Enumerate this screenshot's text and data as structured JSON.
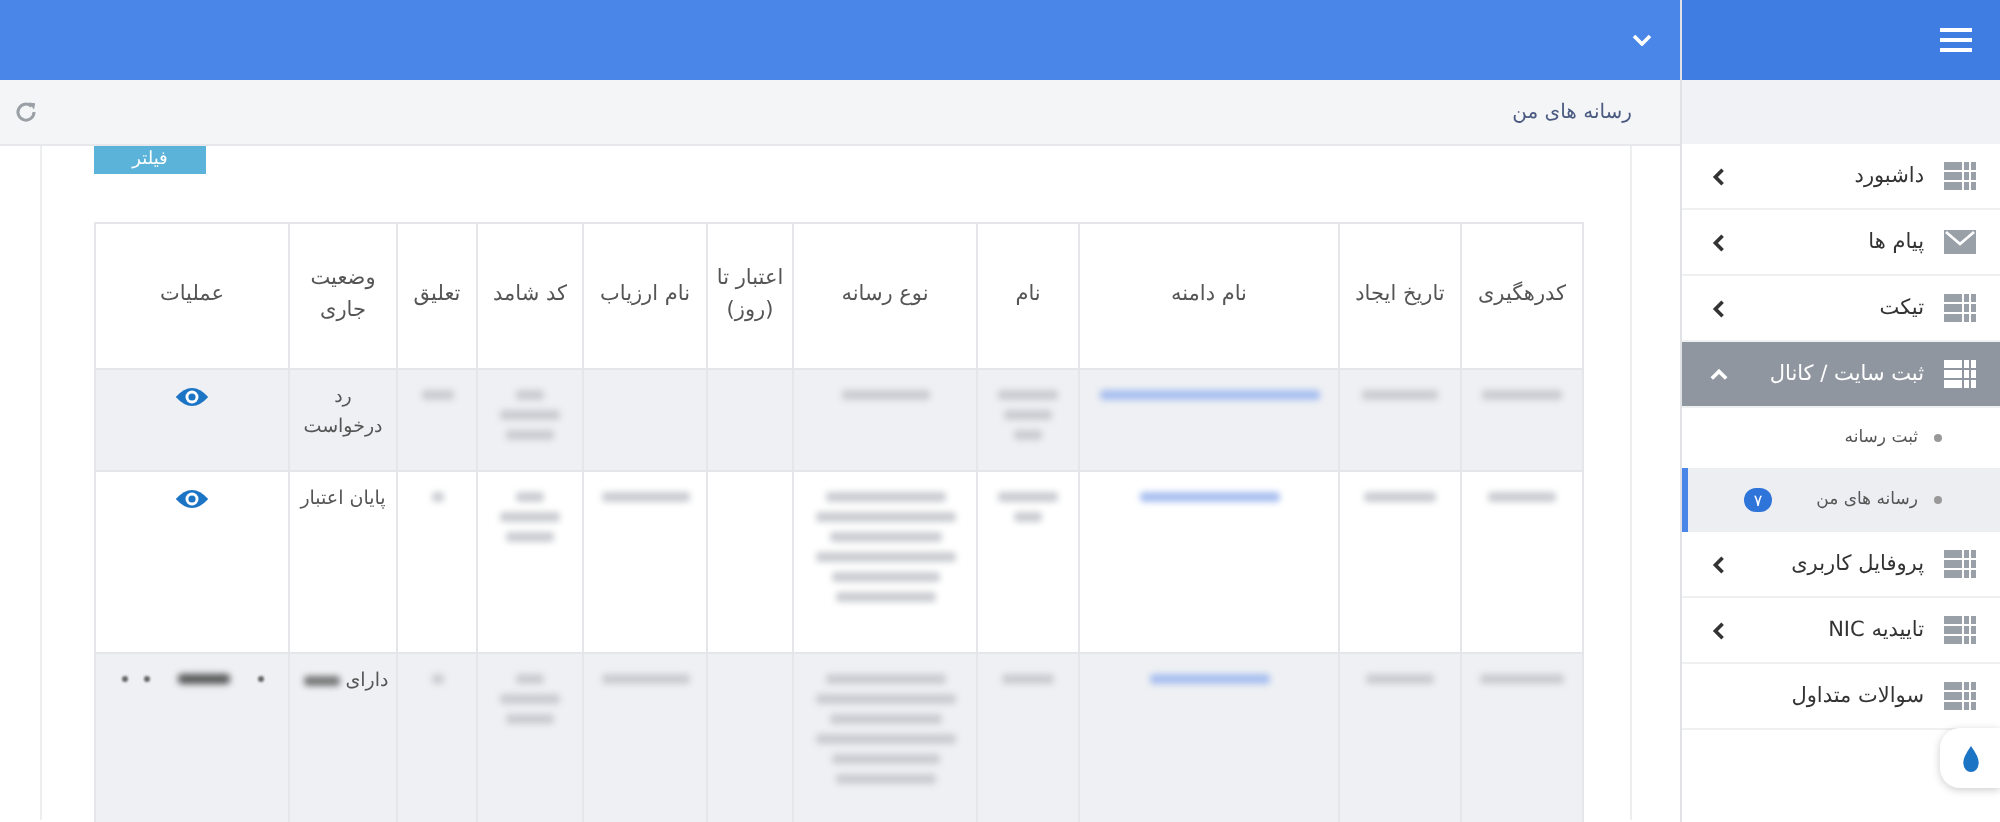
{
  "header": {
    "menu_open": false
  },
  "breadcrumb": {
    "title": "رسانه های من"
  },
  "filter_button": {
    "label": "فیلتر"
  },
  "table": {
    "columns": [
      "کدرهگیری",
      "تاریخ ایجاد",
      "نام دامنه",
      "نام",
      "نوع رسانه",
      "اعتبار تا (روز)",
      "نام ارزیاب",
      "کد شامد",
      "تعلیق",
      "وضعیت جاری",
      "عملیات"
    ],
    "rows": [
      {
        "status": "رد درخواست",
        "kind": "view"
      },
      {
        "status": "پایان اعتبار",
        "kind": "view"
      },
      {
        "status": "دارای",
        "kind": "blurred"
      }
    ]
  },
  "sidebar": {
    "items": [
      {
        "label": "داشبورد",
        "kind": "menu",
        "expanded": false
      },
      {
        "label": "پیام ها",
        "kind": "menu",
        "expanded": false
      },
      {
        "label": "تیکت",
        "kind": "menu",
        "expanded": false
      },
      {
        "label": "ثبت سایت / کانال",
        "kind": "menu",
        "expanded": true,
        "children": [
          {
            "label": "ثبت رسانه",
            "selected": false
          },
          {
            "label": "رسانه های من",
            "selected": true,
            "badge": "۷"
          }
        ]
      },
      {
        "label": "پروفایل کاربری",
        "kind": "menu",
        "expanded": false
      },
      {
        "label": "تاییدیه NIC",
        "kind": "menu",
        "expanded": false
      },
      {
        "label": "سوالات متداول",
        "kind": "link"
      }
    ]
  }
}
